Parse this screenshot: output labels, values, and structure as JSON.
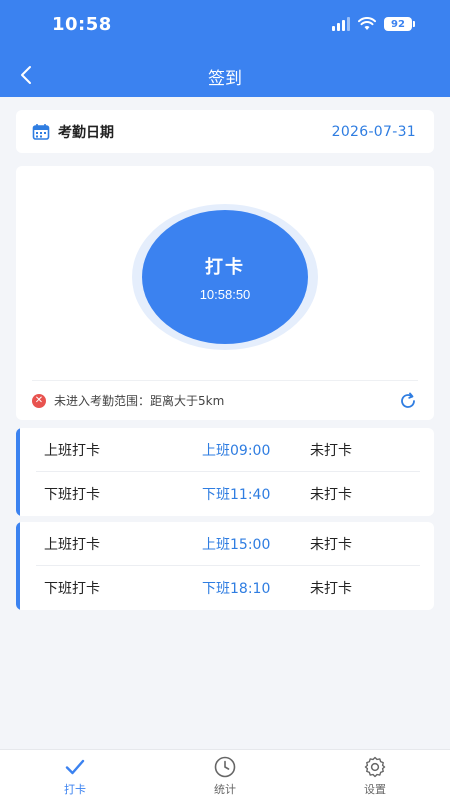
{
  "status_bar": {
    "time": "10:58",
    "battery": "92"
  },
  "nav": {
    "title": "签到"
  },
  "date": {
    "label": "考勤日期",
    "value": "2026-07-31"
  },
  "punch": {
    "label": "打卡",
    "time": "10:58:50"
  },
  "range": {
    "message": "未进入考勤范围：距离大于5km"
  },
  "shifts": [
    {
      "rows": [
        {
          "label": "上班打卡",
          "time": "上班09:00",
          "status": "未打卡"
        },
        {
          "label": "下班打卡",
          "time": "下班11:40",
          "status": "未打卡"
        }
      ]
    },
    {
      "rows": [
        {
          "label": "上班打卡",
          "time": "上班15:00",
          "status": "未打卡"
        },
        {
          "label": "下班打卡",
          "time": "下班18:10",
          "status": "未打卡"
        }
      ]
    }
  ],
  "tabs": [
    {
      "label": "打卡",
      "icon": "checkmark-icon",
      "active": true
    },
    {
      "label": "统计",
      "icon": "clock-icon",
      "active": false
    },
    {
      "label": "设置",
      "icon": "gear-icon",
      "active": false
    }
  ],
  "colors": {
    "primary": "#3b82f0",
    "accent_text": "#2f7de1",
    "error": "#e8534f",
    "background": "#f3f5f9"
  }
}
